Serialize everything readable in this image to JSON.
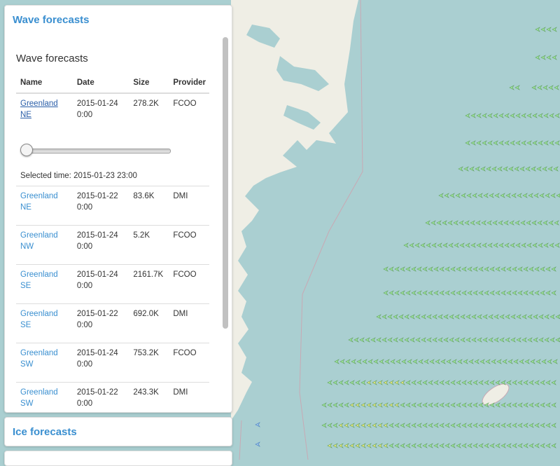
{
  "wave_panel": {
    "heading": "Wave forecasts",
    "inner_title": "Wave forecasts",
    "columns": [
      "Name",
      "Date",
      "Size",
      "Provider"
    ],
    "first_row": {
      "name": "Greenland NE",
      "date": "2015-01-24 0:00",
      "size": "278.2K",
      "provider": "FCOO"
    },
    "slider": {
      "position": 0.0
    },
    "selected_time": "Selected time: 2015-01-23 23:00",
    "rows": [
      {
        "name": "Greenland NE",
        "date": "2015-01-22 0:00",
        "size": "83.6K",
        "provider": "DMI"
      },
      {
        "name": "Greenland NW",
        "date": "2015-01-24 0:00",
        "size": "5.2K",
        "provider": "FCOO"
      },
      {
        "name": "Greenland SE",
        "date": "2015-01-24 0:00",
        "size": "2161.7K",
        "provider": "FCOO"
      },
      {
        "name": "Greenland SE",
        "date": "2015-01-22 0:00",
        "size": "692.0K",
        "provider": "DMI"
      },
      {
        "name": "Greenland SW",
        "date": "2015-01-24 0:00",
        "size": "753.2K",
        "provider": "FCOO"
      },
      {
        "name": "Greenland SW",
        "date": "2015-01-22 0:00",
        "size": "243.3K",
        "provider": "DMI"
      }
    ]
  },
  "ice_panel": {
    "heading": "Ice forecasts"
  },
  "map": {
    "sea_color": "#aacfd1",
    "land_color": "#efeee5",
    "arrow_green": "#9ee59a",
    "arrow_yellow": "#efe87a"
  }
}
